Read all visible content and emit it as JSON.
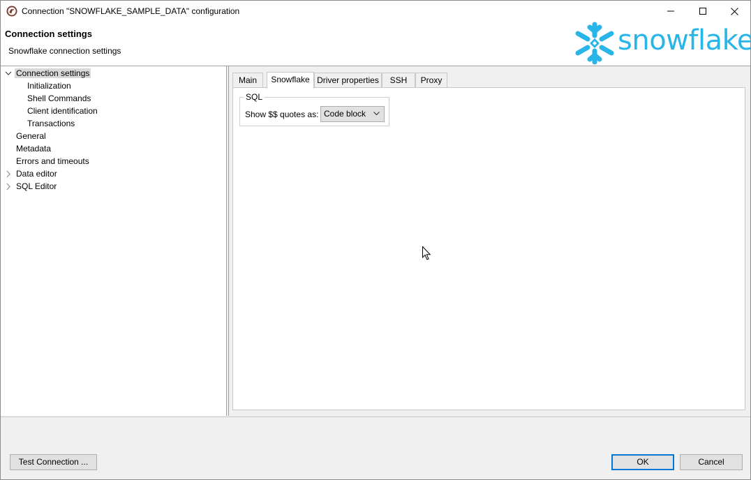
{
  "window": {
    "title": "Connection \"SNOWFLAKE_SAMPLE_DATA\" configuration",
    "icon": "dbeaver-app-icon",
    "controls": [
      "minimize-icon",
      "maximize-icon",
      "close-icon"
    ]
  },
  "header": {
    "title": "Connection settings",
    "subtitle": "Snowflake connection settings",
    "logo_text": "snowflake",
    "logo_color": "#29b5e8"
  },
  "tree": {
    "items": [
      {
        "label": "Connection settings",
        "expanded": true,
        "selected": true
      },
      {
        "label": "Initialization"
      },
      {
        "label": "Shell Commands"
      },
      {
        "label": "Client identification"
      },
      {
        "label": "Transactions"
      },
      {
        "label": "General"
      },
      {
        "label": "Metadata"
      },
      {
        "label": "Errors and timeouts"
      },
      {
        "label": "Data editor",
        "expandable": true
      },
      {
        "label": "SQL Editor",
        "expandable": true
      }
    ]
  },
  "tabs": {
    "items": [
      "Main",
      "Snowflake",
      "Driver properties",
      "SSH",
      "Proxy"
    ],
    "active": "Snowflake"
  },
  "snowflake_tab": {
    "group_title": "SQL",
    "field_label": "Show $$ quotes as:",
    "field_value": "Code block"
  },
  "buttons": {
    "test_connection": "Test Connection ...",
    "ok": "OK",
    "cancel": "Cancel"
  },
  "colors": {
    "accent": "#0078d7",
    "selection": "#d9d9d9"
  }
}
